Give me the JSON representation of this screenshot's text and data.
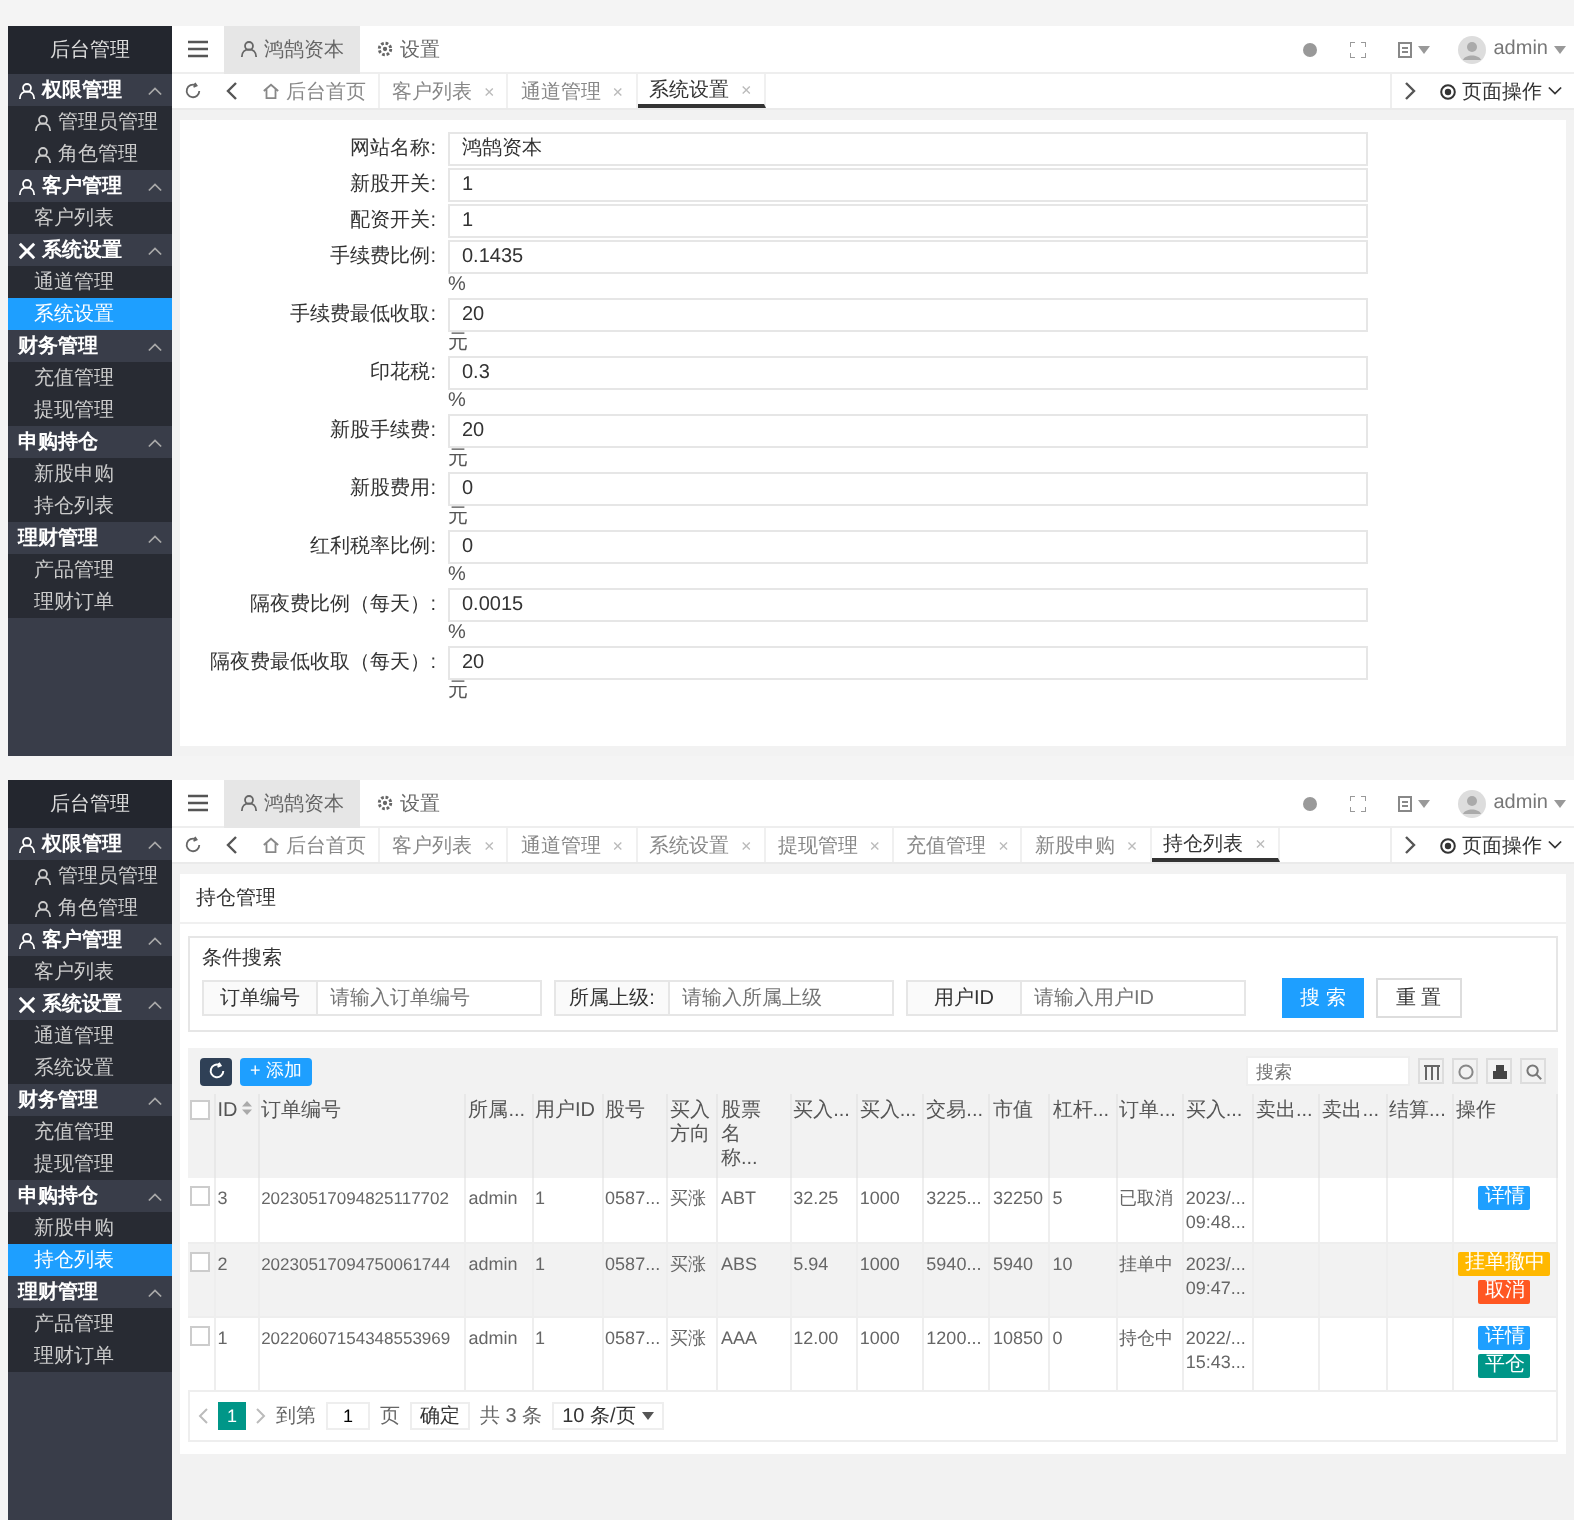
{
  "screens": [
    {
      "kind": "form",
      "sidebar": {
        "title": "后台管理",
        "groups": [
          {
            "label": "权限管理",
            "expanded": true,
            "items": [
              {
                "label": "管理员管理",
                "selected": false
              },
              {
                "label": "角色管理",
                "selected": false
              }
            ]
          },
          {
            "label": "客户管理",
            "expanded": true,
            "items": [
              {
                "label": "客户列表",
                "selected": false
              }
            ]
          },
          {
            "label": "系统设置",
            "expanded": true,
            "items": [
              {
                "label": "通道管理",
                "selected": false
              },
              {
                "label": "系统设置",
                "selected": true
              }
            ]
          },
          {
            "label": "财务管理",
            "expanded": true,
            "items": [
              {
                "label": "充值管理",
                "selected": false
              },
              {
                "label": "提现管理",
                "selected": false
              }
            ]
          },
          {
            "label": "申购持仓",
            "expanded": true,
            "items": [
              {
                "label": "新股申购",
                "selected": false
              },
              {
                "label": "持仓列表",
                "selected": false
              }
            ]
          },
          {
            "label": "理财管理",
            "expanded": true,
            "items": [
              {
                "label": "产品管理",
                "selected": false
              },
              {
                "label": "理财订单",
                "selected": false
              }
            ]
          }
        ]
      },
      "header": {
        "top_tabs": [
          {
            "label": "鸿鹄资本",
            "selected": true
          },
          {
            "label": "设置",
            "selected": false
          }
        ],
        "user": "admin"
      },
      "tabs": [
        {
          "label": "后台首页",
          "selected": false
        },
        {
          "label": "客户列表",
          "close_mark": "×",
          "selected": false
        },
        {
          "label": "通道管理",
          "close_mark": "×",
          "selected": false
        },
        {
          "label": "系统设置",
          "close_mark": "×",
          "selected": true
        }
      ],
      "page_ops": "页面操作",
      "fields": [
        {
          "label": "网站名称:",
          "value": "鸿鹄资本"
        },
        {
          "label": "新股开关:",
          "value": "1"
        },
        {
          "label": "配资开关:",
          "value": "1"
        },
        {
          "label": "手续费比例:",
          "value": "0.1435",
          "unit": "%"
        },
        {
          "label": "手续费最低收取:",
          "value": "20",
          "unit": "元"
        },
        {
          "label": "印花税:",
          "value": "0.3",
          "unit": "%"
        },
        {
          "label": "新股手续费:",
          "value": "20",
          "unit": "元"
        },
        {
          "label": "新股费用:",
          "value": "0",
          "unit": "元"
        },
        {
          "label": "红利税率比例:",
          "value": "0",
          "unit": "%"
        },
        {
          "label": "隔夜费比例（每天）:",
          "value": "0.0015",
          "unit": "%"
        },
        {
          "label": "隔夜费最低收取（每天）:",
          "value": "20",
          "unit": "元"
        }
      ]
    },
    {
      "kind": "table",
      "sidebar": {
        "title": "后台管理",
        "groups": [
          {
            "label": "权限管理",
            "expanded": true,
            "items": [
              {
                "label": "管理员管理",
                "selected": false
              },
              {
                "label": "角色管理",
                "selected": false
              }
            ]
          },
          {
            "label": "客户管理",
            "expanded": true,
            "items": [
              {
                "label": "客户列表",
                "selected": false
              }
            ]
          },
          {
            "label": "系统设置",
            "expanded": true,
            "items": [
              {
                "label": "通道管理",
                "selected": false
              },
              {
                "label": "系统设置",
                "selected": false
              }
            ]
          },
          {
            "label": "财务管理",
            "expanded": true,
            "items": [
              {
                "label": "充值管理",
                "selected": false
              },
              {
                "label": "提现管理",
                "selected": false
              }
            ]
          },
          {
            "label": "申购持仓",
            "expanded": true,
            "items": [
              {
                "label": "新股申购",
                "selected": false
              },
              {
                "label": "持仓列表",
                "selected": true
              }
            ]
          },
          {
            "label": "理财管理",
            "expanded": true,
            "items": [
              {
                "label": "产品管理",
                "selected": false
              },
              {
                "label": "理财订单",
                "selected": false
              }
            ]
          }
        ]
      },
      "header": {
        "top_tabs": [
          {
            "label": "鸿鹄资本",
            "selected": true
          },
          {
            "label": "设置",
            "selected": false
          }
        ],
        "user": "admin"
      },
      "tabs": [
        {
          "label": "后台首页",
          "selected": false
        },
        {
          "label": "客户列表",
          "close_mark": "×",
          "selected": false
        },
        {
          "label": "通道管理",
          "close_mark": "×",
          "selected": false
        },
        {
          "label": "系统设置",
          "close_mark": "×",
          "selected": false
        },
        {
          "label": "提现管理",
          "close_mark": "×",
          "selected": false
        },
        {
          "label": "充值管理",
          "close_mark": "×",
          "selected": false
        },
        {
          "label": "新股申购",
          "close_mark": "×",
          "selected": false
        },
        {
          "label": "持仓列表",
          "close_mark": "×",
          "selected": true
        }
      ],
      "page_ops": "页面操作",
      "title": "持仓管理",
      "filter": {
        "legend": "条件搜索",
        "fields": [
          {
            "label": "订单编号",
            "placeholder": "请输入订单编号"
          },
          {
            "label": "所属上级:",
            "placeholder": "请输入所属上级"
          },
          {
            "label": "用户ID",
            "placeholder": "请输入用户ID"
          }
        ],
        "search": "搜 索",
        "reset": "重 置"
      },
      "toolbar": {
        "add": "+ 添加",
        "search_placeholder": "搜索"
      },
      "header_checked": false,
      "columns": [
        "ID",
        "订单编号",
        "所属...",
        "用户ID",
        "股号",
        "买入方向",
        "股票名称...",
        "买入...",
        "买入...",
        "交易...",
        "市值",
        "杠杆...",
        "订单...",
        "买入...",
        "卖出...",
        "卖出...",
        "结算...",
        "操作"
      ],
      "rows": [
        {
          "checked": false,
          "cells": [
            "3",
            "20230517094825117702",
            "admin",
            "1",
            "0587...",
            "买涨",
            "ABT",
            "32.25",
            "1000",
            "3225...",
            "32250",
            "5",
            "已取消",
            "2023/...\n09:48...",
            "",
            "",
            ""
          ],
          "actions": [
            {
              "label": "详情",
              "kind": "info"
            }
          ]
        },
        {
          "checked": false,
          "cells": [
            "2",
            "20230517094750061744",
            "admin",
            "1",
            "0587...",
            "买涨",
            "ABS",
            "5.94",
            "1000",
            "5940...",
            "5940",
            "10",
            "挂单中",
            "2023/...\n09:47...",
            "",
            "",
            ""
          ],
          "actions": [
            {
              "label": "挂单撤中",
              "kind": "warn"
            },
            {
              "label": "取消",
              "kind": "danger"
            }
          ]
        },
        {
          "checked": false,
          "cells": [
            "1",
            "20220607154348553969",
            "admin",
            "1",
            "0587...",
            "买涨",
            "AAA",
            "12.00",
            "1000",
            "1200...",
            "10850",
            "0",
            "持仓中",
            "2022/...\n15:43...",
            "",
            "",
            ""
          ],
          "actions": [
            {
              "label": "详情",
              "kind": "info"
            },
            {
              "label": "平仓",
              "kind": "ok"
            }
          ]
        }
      ],
      "pagination": {
        "pages": [
          {
            "label": "1",
            "selected": true
          }
        ],
        "goto": "到第",
        "page_value": "1",
        "page_unit": "页",
        "confirm": "确定",
        "total": "共 3 条",
        "per_page": "10 条/页"
      }
    }
  ]
}
